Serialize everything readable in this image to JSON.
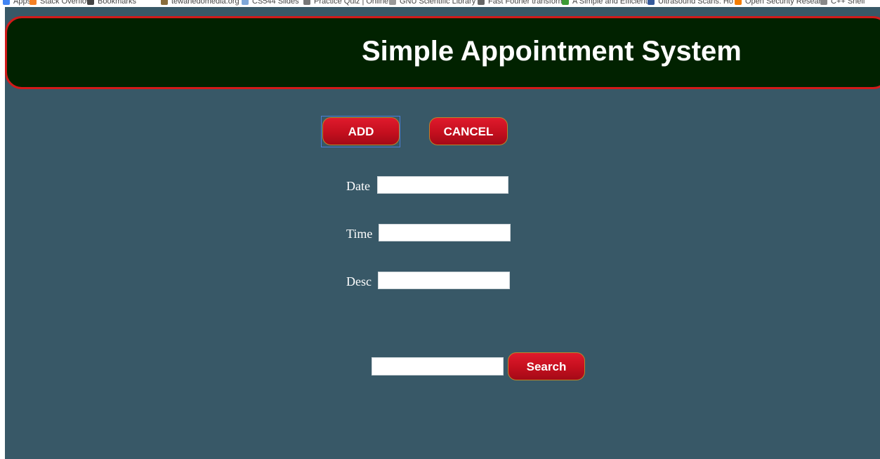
{
  "bookmarks": [
    {
      "label": "Apps",
      "icon": "apps-grid-icon",
      "color": "#4285f4"
    },
    {
      "label": "Stack Overflow",
      "icon": "stackoverflow-icon",
      "color": "#f48024"
    },
    {
      "label": "Bookmarks",
      "icon": "star-icon",
      "color": "#444444"
    },
    {
      "label": "tewanedomedia.org",
      "icon": "site-favicon-icon",
      "color": "#8a6d3b"
    },
    {
      "label": "CS544 Slides",
      "icon": "slides-icon",
      "color": "#7fa7d8"
    },
    {
      "label": "Practice Quiz | Online",
      "icon": "quiz-icon",
      "color": "#777777"
    },
    {
      "label": "GNU Scientific Library",
      "icon": "gnu-icon",
      "color": "#999999"
    },
    {
      "label": "Fast Fourier transform",
      "icon": "wiki-icon",
      "color": "#666666"
    },
    {
      "label": "A Simple and Efficient",
      "icon": "doc-icon",
      "color": "#3d9b35"
    },
    {
      "label": "Ultrasound Scans: Ho",
      "icon": "scan-icon",
      "color": "#355a9b"
    },
    {
      "label": "Open Security Resear",
      "icon": "blogger-icon",
      "color": "#f57d00"
    },
    {
      "label": "C++ Shell",
      "icon": "page-icon",
      "color": "#888888"
    }
  ],
  "header": {
    "title": "Simple Appointment System"
  },
  "buttons": {
    "add": "ADD",
    "cancel": "CANCEL",
    "search": "Search"
  },
  "form": {
    "date_label": "Date",
    "time_label": "Time",
    "desc_label": "Desc",
    "date_value": "",
    "time_value": "",
    "desc_value": "",
    "search_value": ""
  },
  "colors": {
    "page_background": "#385867",
    "header_background": "#012200",
    "header_border": "#d21a1a",
    "button_red": "#c40f1e"
  }
}
